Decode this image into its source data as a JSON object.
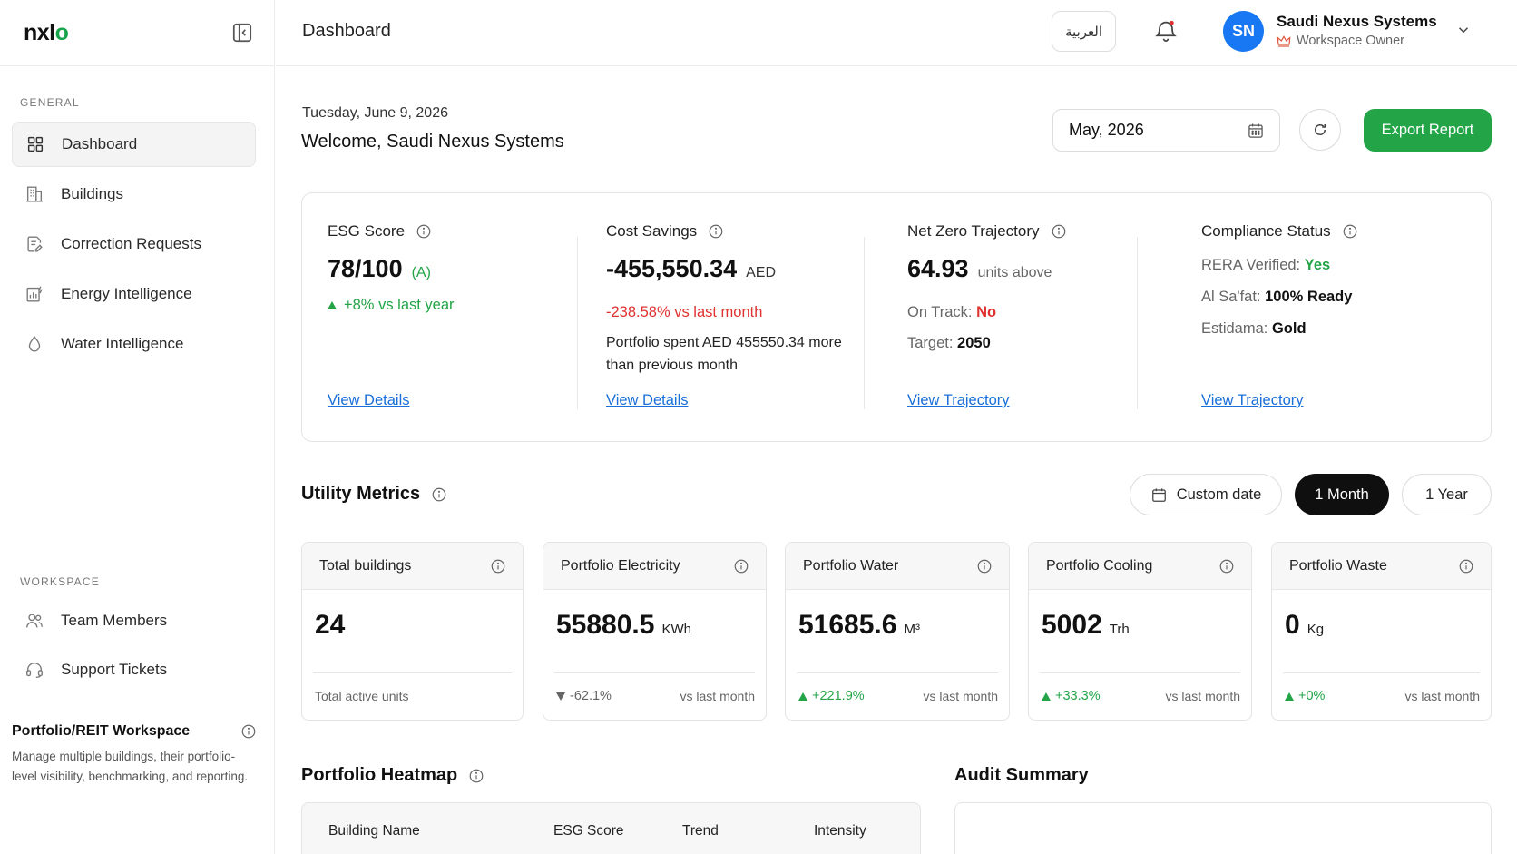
{
  "sidebar": {
    "logo_main": "nxl",
    "logo_accent": "o",
    "general_label": "GENERAL",
    "workspace_label": "WORKSPACE",
    "general_items": [
      {
        "label": "Dashboard",
        "icon": "grid-icon",
        "active": true
      },
      {
        "label": "Buildings",
        "icon": "building-icon"
      },
      {
        "label": "Correction Requests",
        "icon": "document-edit-icon"
      },
      {
        "label": "Energy Intelligence",
        "icon": "energy-chart-icon"
      },
      {
        "label": "Water Intelligence",
        "icon": "water-drop-icon"
      }
    ],
    "workspace_items": [
      {
        "label": "Team Members",
        "icon": "users-icon"
      },
      {
        "label": "Support Tickets",
        "icon": "headset-icon"
      }
    ],
    "workspace_card": {
      "title": "Portfolio/REIT Workspace",
      "description": "Manage multiple buildings, their portfolio-level visibility, benchmarking, and reporting."
    }
  },
  "topbar": {
    "title": "Dashboard",
    "language_button": "العربية",
    "user": {
      "initials": "SN",
      "name": "Saudi Nexus Systems",
      "role": "Workspace Owner"
    }
  },
  "header": {
    "date": "Tuesday, June 9, 2026",
    "welcome": "Welcome, Saudi Nexus Systems",
    "month_picker": "May, 2026",
    "export_button": "Export Report"
  },
  "kpis": {
    "esg": {
      "title": "ESG Score",
      "value": "78/100",
      "grade": "(A)",
      "change": "+8% vs last year",
      "link": "View Details"
    },
    "cost": {
      "title": "Cost Savings",
      "value": "-455,550.34",
      "unit": "AED",
      "change": "-238.58% vs last month",
      "description": "Portfolio spent AED 455550.34 more than previous month",
      "link": "View Details"
    },
    "netzero": {
      "title": "Net Zero Trajectory",
      "value": "64.93",
      "unit": "units above",
      "on_track_label": "On Track:",
      "on_track_value": "No",
      "target_label": "Target:",
      "target_value": "2050",
      "link": "View Trajectory"
    },
    "compliance": {
      "title": "Compliance Status",
      "rera_label": "RERA Verified:",
      "rera_value": "Yes",
      "alsafat_label": "Al Sa'fat:",
      "alsafat_value": "100% Ready",
      "estidama_label": "Estidama:",
      "estidama_value": "Gold",
      "link": "View Trajectory"
    }
  },
  "utility": {
    "title": "Utility Metrics",
    "custom_date": "Custom date",
    "one_month": "1 Month",
    "one_year": "1 Year",
    "selected_range": "1 Month",
    "metrics": [
      {
        "title": "Total buildings",
        "value": "24",
        "unit": "",
        "footer": "Total active units"
      },
      {
        "title": "Portfolio Electricity",
        "value": "55880.5",
        "unit": "KWh",
        "change": "-62.1%",
        "direction": "down",
        "footer": "vs last month"
      },
      {
        "title": "Portfolio Water",
        "value": "51685.6",
        "unit": "M³",
        "change": "+221.9%",
        "direction": "up",
        "footer": "vs last month"
      },
      {
        "title": "Portfolio Cooling",
        "value": "5002",
        "unit": "Trh",
        "change": "+33.3%",
        "direction": "up",
        "footer": "vs last month"
      },
      {
        "title": "Portfolio Waste",
        "value": "0",
        "unit": "Kg",
        "change": "+0%",
        "direction": "up",
        "footer": "vs last month"
      }
    ]
  },
  "heatmap": {
    "title": "Portfolio Heatmap",
    "columns": [
      "Building Name",
      "ESG Score",
      "Trend",
      "Intensity"
    ]
  },
  "audit": {
    "title": "Audit Summary"
  },
  "colors": {
    "accent_green": "#22a447",
    "negative_red": "#e03131",
    "link_blue": "#1a6fd8",
    "avatar_blue": "#1877f2"
  }
}
